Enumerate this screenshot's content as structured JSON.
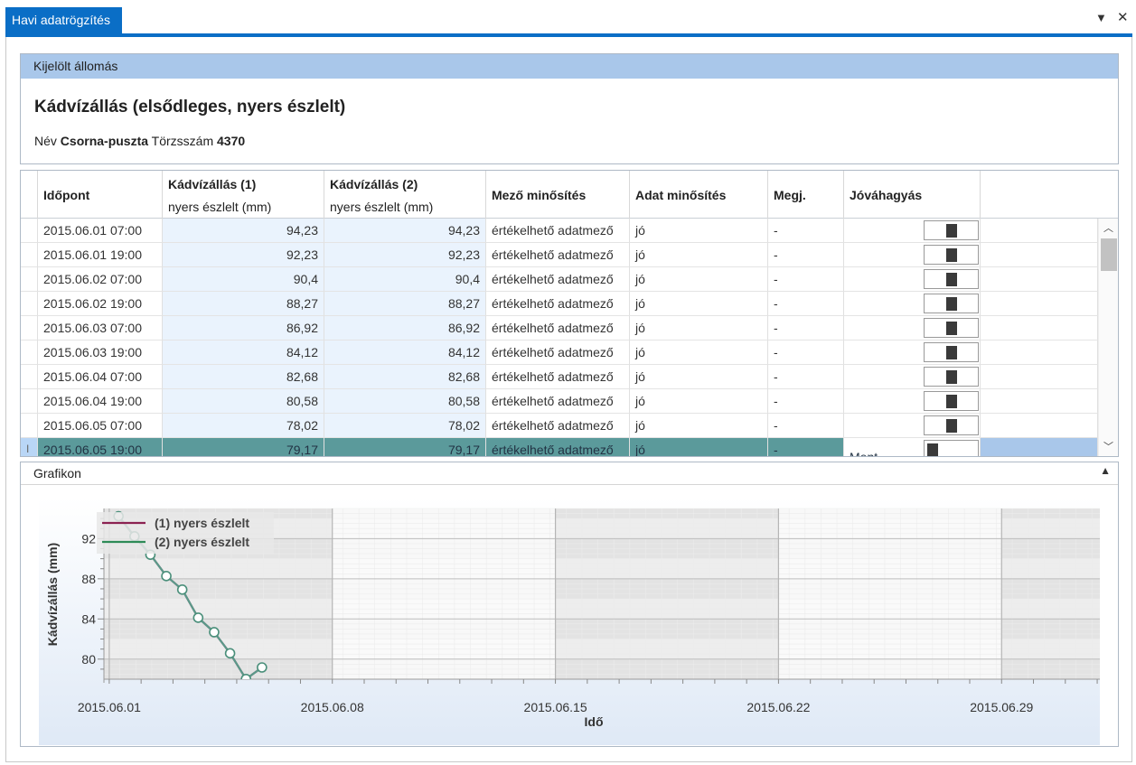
{
  "window": {
    "tab_title": "Havi adatrögzítés",
    "menu_icon": "triangle-down-icon",
    "close_icon": "close-icon"
  },
  "station": {
    "header": "Kijelölt állomás",
    "title": "Kádvízállás (elsődleges, nyers észlelt)",
    "name_label": "Név",
    "name_value": "Csorna-puszta",
    "id_label": "Törzsszám",
    "id_value": "4370"
  },
  "table": {
    "columns": {
      "time": "Időpont",
      "k1_title": "Kádvízállás (1)",
      "k1_sub": "nyers észlelt (mm)",
      "k2_title": "Kádvízállás (2)",
      "k2_sub": "nyers észlelt (mm)",
      "field_q": "Mező minősítés",
      "data_q": "Adat minősítés",
      "note": "Megj.",
      "approve": "Jóváhagyás"
    },
    "rows": [
      {
        "time": "2015.06.01 07:00",
        "k1": "94,23",
        "k2": "94,23",
        "fq": "értékelhető adatmező",
        "dq": "jó",
        "note": "-",
        "app": ""
      },
      {
        "time": "2015.06.01 19:00",
        "k1": "92,23",
        "k2": "92,23",
        "fq": "értékelhető adatmező",
        "dq": "jó",
        "note": "-",
        "app": ""
      },
      {
        "time": "2015.06.02 07:00",
        "k1": "90,4",
        "k2": "90,4",
        "fq": "értékelhető adatmező",
        "dq": "jó",
        "note": "-",
        "app": ""
      },
      {
        "time": "2015.06.02 19:00",
        "k1": "88,27",
        "k2": "88,27",
        "fq": "értékelhető adatmező",
        "dq": "jó",
        "note": "-",
        "app": ""
      },
      {
        "time": "2015.06.03 07:00",
        "k1": "86,92",
        "k2": "86,92",
        "fq": "értékelhető adatmező",
        "dq": "jó",
        "note": "-",
        "app": ""
      },
      {
        "time": "2015.06.03 19:00",
        "k1": "84,12",
        "k2": "84,12",
        "fq": "értékelhető adatmező",
        "dq": "jó",
        "note": "-",
        "app": ""
      },
      {
        "time": "2015.06.04 07:00",
        "k1": "82,68",
        "k2": "82,68",
        "fq": "értékelhető adatmező",
        "dq": "jó",
        "note": "-",
        "app": ""
      },
      {
        "time": "2015.06.04 19:00",
        "k1": "80,58",
        "k2": "80,58",
        "fq": "értékelhető adatmező",
        "dq": "jó",
        "note": "-",
        "app": ""
      },
      {
        "time": "2015.06.05 07:00",
        "k1": "78,02",
        "k2": "78,02",
        "fq": "értékelhető adatmező",
        "dq": "jó",
        "note": "-",
        "app": ""
      },
      {
        "time": "2015.06.05 19:00",
        "k1": "79,17",
        "k2": "79,17",
        "fq": "értékelhető adatmező",
        "dq": "jó",
        "note": "-",
        "app": "Ment"
      }
    ]
  },
  "graph": {
    "header": "Grafikon",
    "collapse_icon": "triangle-up-icon"
  },
  "chart_data": {
    "type": "line",
    "xlabel": "Idő",
    "ylabel": "Kádvízállás (mm)",
    "x_ticks": [
      "2015.06.01",
      "2015.06.08",
      "2015.06.15",
      "2015.06.22",
      "2015.06.29"
    ],
    "y_ticks": [
      80,
      84,
      88,
      92
    ],
    "xlim": [
      "2015.05.31",
      "2015.07.02"
    ],
    "ylim": [
      78,
      95
    ],
    "legend_position": "top-left",
    "x": [
      "2015.06.01 07:00",
      "2015.06.01 19:00",
      "2015.06.02 07:00",
      "2015.06.02 19:00",
      "2015.06.03 07:00",
      "2015.06.03 19:00",
      "2015.06.04 07:00",
      "2015.06.04 19:00",
      "2015.06.05 07:00",
      "2015.06.05 19:00"
    ],
    "series": [
      {
        "name": "(1) nyers észlelt",
        "color": "#8b2252",
        "values": [
          94.23,
          92.23,
          90.4,
          88.27,
          86.92,
          84.12,
          82.68,
          80.58,
          78.02,
          79.17
        ]
      },
      {
        "name": "(2) nyers észlelt",
        "color": "#2e8b57",
        "values": [
          94.23,
          92.23,
          90.4,
          88.27,
          86.92,
          84.12,
          82.68,
          80.58,
          78.02,
          79.17
        ]
      }
    ]
  }
}
